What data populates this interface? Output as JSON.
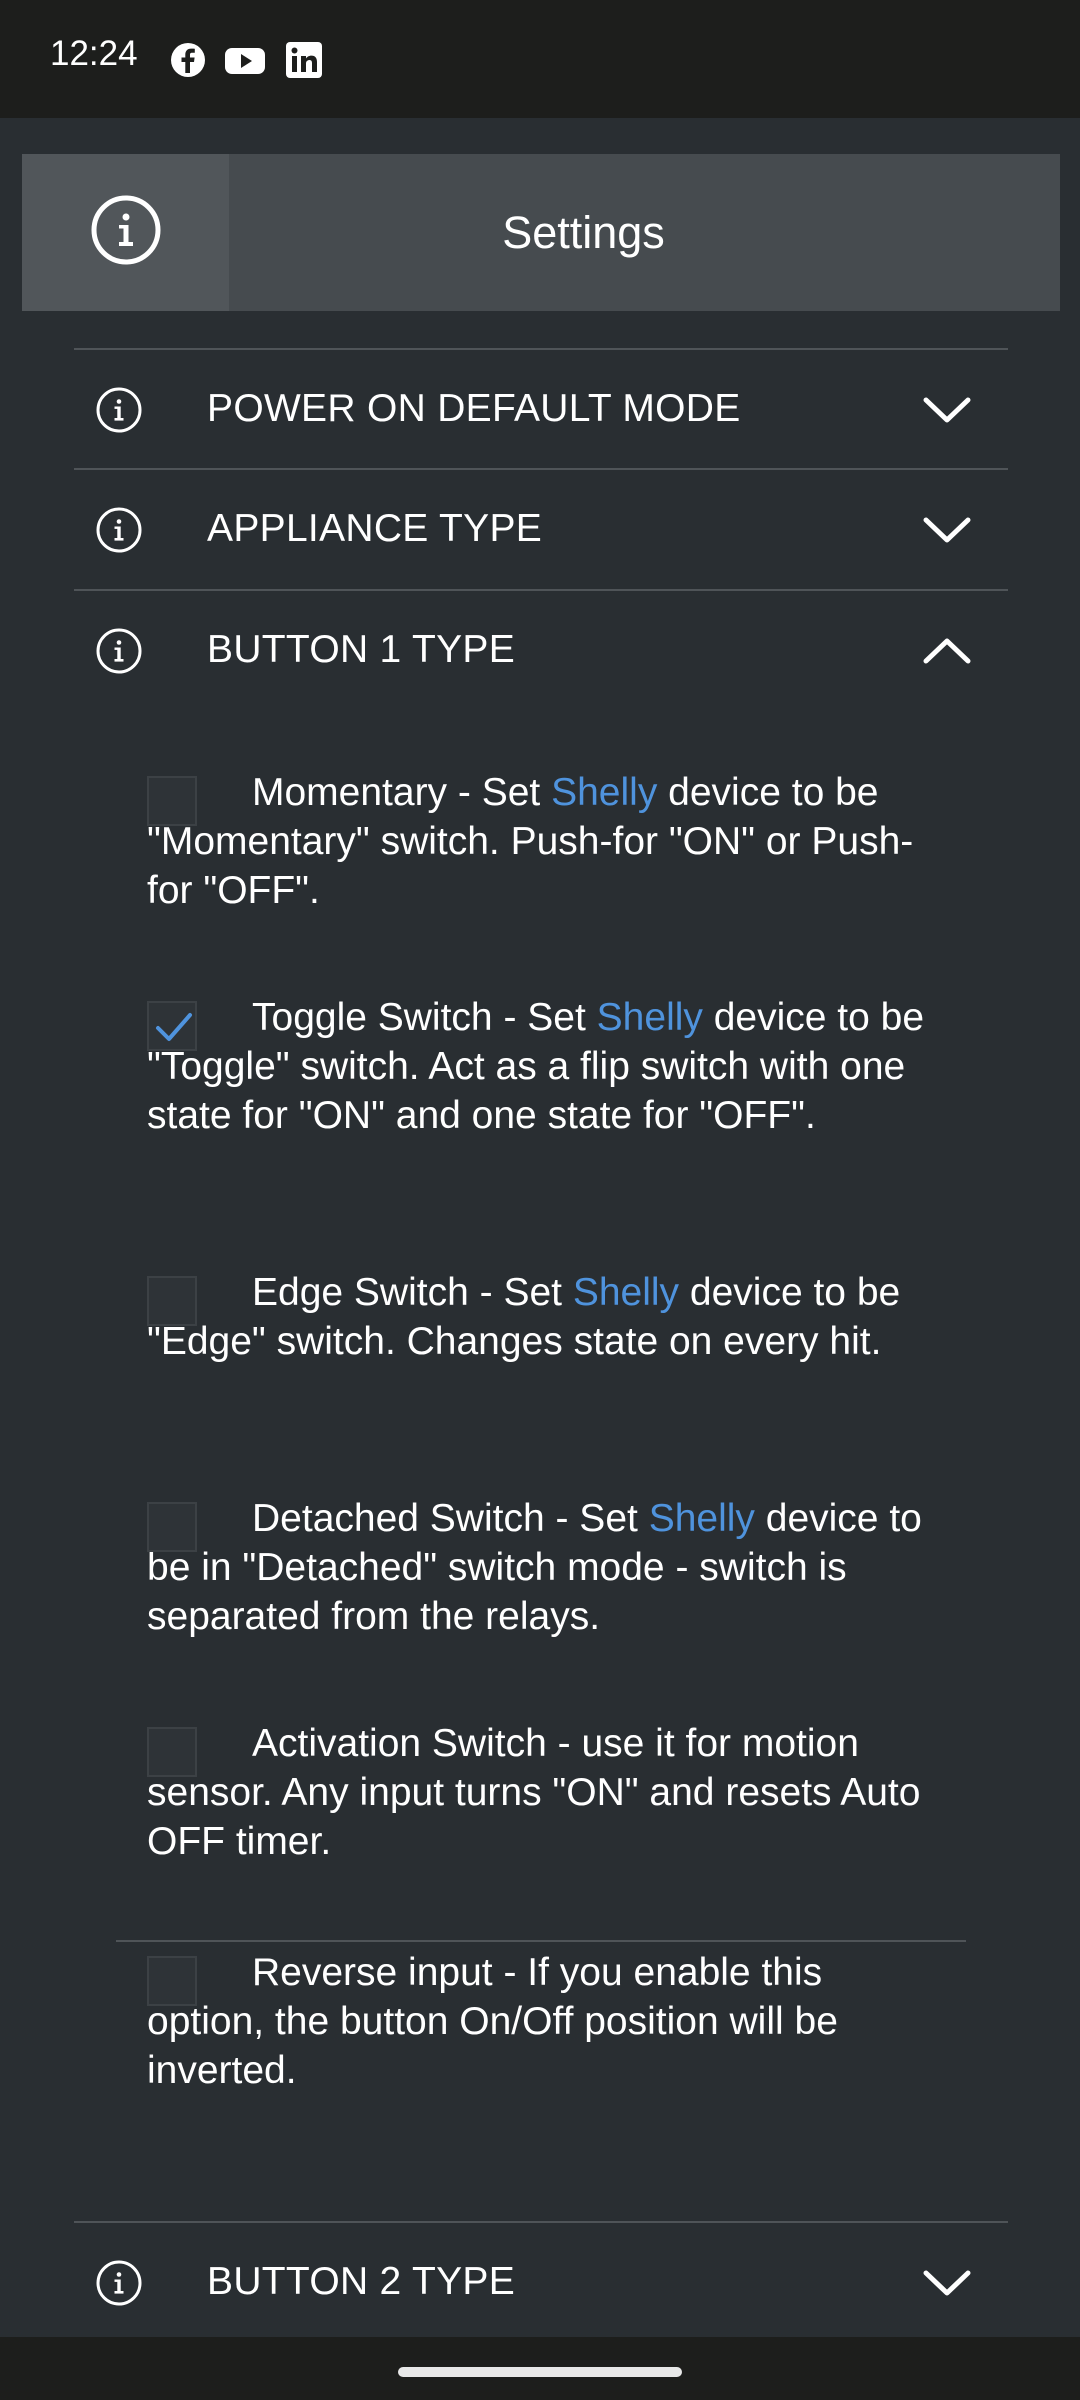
{
  "status_bar": {
    "time": "12:24",
    "icons": [
      "facebook-icon",
      "youtube-icon",
      "linkedin-icon"
    ]
  },
  "header": {
    "title": "Settings",
    "info_icon": "info-icon"
  },
  "sections": {
    "power_on": {
      "label": "POWER ON DEFAULT MODE",
      "expanded": false
    },
    "appliance": {
      "label": "APPLIANCE TYPE",
      "expanded": false
    },
    "button1": {
      "label": "BUTTON 1 TYPE",
      "expanded": true
    },
    "button2": {
      "label": "BUTTON 2 TYPE",
      "expanded": false
    }
  },
  "button1_options": {
    "momentary": {
      "checked": false,
      "pre": "Momentary - Set ",
      "highlight": "Shelly",
      "post": " device to be \"Momentary\" switch. Push-for \"ON\" or Push-for \"OFF\"."
    },
    "toggle": {
      "checked": true,
      "pre": "Toggle Switch - Set ",
      "highlight": "Shelly",
      "post": " device to be \"Toggle\" switch. Act as a flip switch with one state for \"ON\" and one state for \"OFF\"."
    },
    "edge": {
      "checked": false,
      "pre": "Edge Switch - Set ",
      "highlight": "Shelly",
      "post": " device to be \"Edge\" switch. Changes state on every hit."
    },
    "detached": {
      "checked": false,
      "pre": "Detached Switch - Set ",
      "highlight": "Shelly",
      "post": " device to be in \"Detached\" switch mode - switch is separated from the relays."
    },
    "activation": {
      "checked": false,
      "pre": "Activation Switch - use it for motion sensor. Any input turns \"ON\" and resets Auto OFF timer."
    },
    "reverse": {
      "checked": false,
      "pre": "Reverse input - If you enable this option, the button On/Off position will be inverted."
    }
  },
  "colors": {
    "background": "#292e32",
    "header": "#464b4f",
    "highlight": "#4f93dd",
    "checkmark": "#4f93dd"
  }
}
